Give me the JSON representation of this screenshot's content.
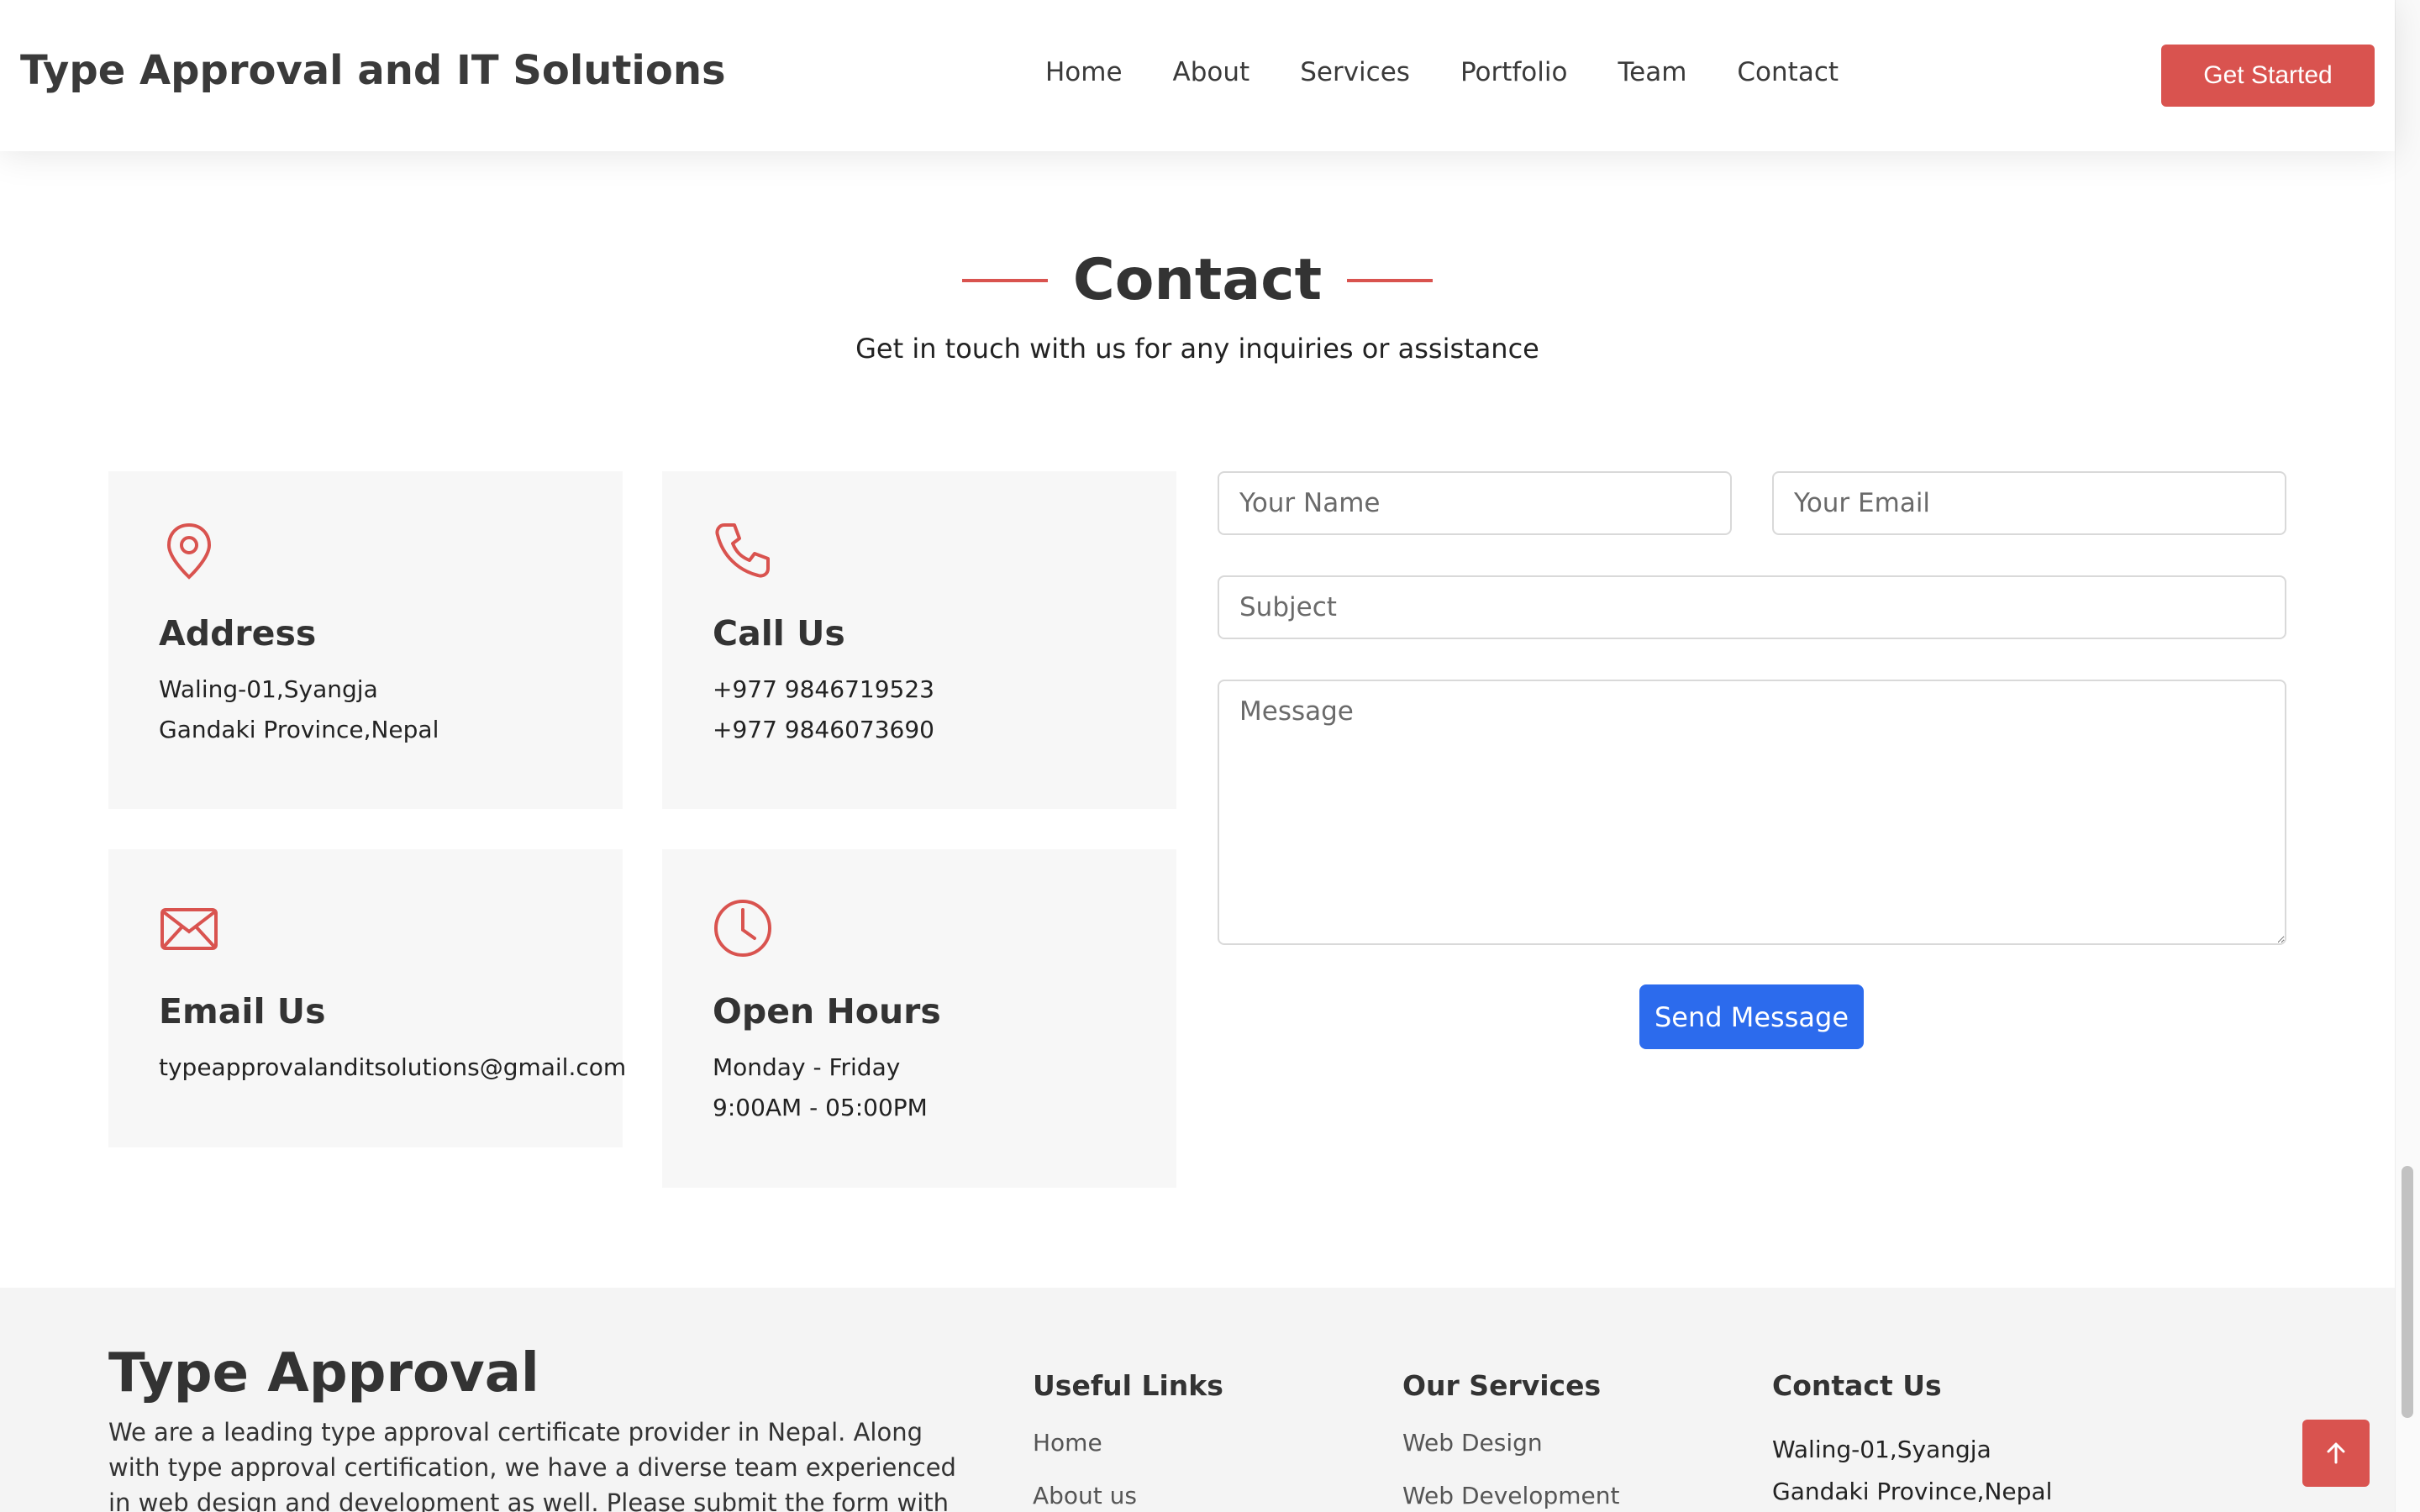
{
  "header": {
    "logo": "Type Approval and IT Solutions",
    "nav": [
      "Home",
      "About",
      "Services",
      "Portfolio",
      "Team",
      "Contact"
    ],
    "cta_label": "Get Started"
  },
  "contact_section": {
    "title": "Contact",
    "subtitle": "Get in touch with us for any inquiries or assistance",
    "cards": {
      "address": {
        "icon": "map-pin-icon",
        "title": "Address",
        "lines": [
          "Waling-01,Syangja",
          "Gandaki Province,Nepal"
        ]
      },
      "call": {
        "icon": "phone-icon",
        "title": "Call Us",
        "lines": [
          "+977 9846719523",
          "+977 9846073690"
        ]
      },
      "email": {
        "icon": "envelope-icon",
        "title": "Email Us",
        "lines": [
          "typeapprovalanditsolutions@gmail.com"
        ]
      },
      "hours": {
        "icon": "clock-icon",
        "title": "Open Hours",
        "lines": [
          "Monday - Friday",
          "9:00AM - 05:00PM"
        ]
      }
    },
    "form": {
      "name_placeholder": "Your Name",
      "email_placeholder": "Your Email",
      "subject_placeholder": "Subject",
      "message_placeholder": "Message",
      "submit_label": "Send Message"
    }
  },
  "footer": {
    "brand": "Type Approval",
    "about": "We are a leading type approval certificate provider in Nepal. Along with type approval certification, we have a diverse team experienced in web design and development as well. Please submit the form with your",
    "useful_links": {
      "title": "Useful Links",
      "items": [
        "Home",
        "About us"
      ]
    },
    "services": {
      "title": "Our Services",
      "items": [
        "Web Design",
        "Web Development"
      ]
    },
    "contact": {
      "title": "Contact Us",
      "lines": [
        "Waling-01,Syangja",
        "Gandaki Province,Nepal"
      ]
    }
  },
  "colors": {
    "accent": "#d9534f",
    "primary_button": "#2c6bed",
    "card_bg": "#f7f7f7"
  },
  "back_to_top_icon": "arrow-up-icon"
}
